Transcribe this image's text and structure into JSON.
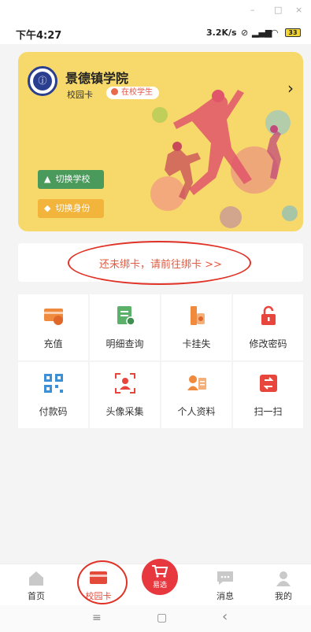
{
  "window": {
    "minimize": "–",
    "maximize": "□",
    "close": "×"
  },
  "status_bar": {
    "time": "下午4:27",
    "speed": "3.2K/s",
    "battery": "33"
  },
  "campus_card": {
    "school_name": "景德镇学院",
    "card_type": "校园卡",
    "status": "在校学生",
    "switch_school": "切换学校",
    "switch_role": "切换身份",
    "bg_color": "#f6d96a"
  },
  "bind_notice": {
    "text": "还未绑卡，请前往绑卡 >>"
  },
  "functions": [
    {
      "label": "充值",
      "icon": "recharge-card-icon",
      "color": "#f08a3c"
    },
    {
      "label": "明细查询",
      "icon": "detail-query-icon",
      "color": "#5bb06a"
    },
    {
      "label": "卡挂失",
      "icon": "card-loss-icon",
      "color": "#f08a3c"
    },
    {
      "label": "修改密码",
      "icon": "lock-icon",
      "color": "#e8453c"
    },
    {
      "label": "付款码",
      "icon": "qr-code-icon",
      "color": "#3d8fd6"
    },
    {
      "label": "头像采集",
      "icon": "avatar-capture-icon",
      "color": "#e8453c"
    },
    {
      "label": "个人资料",
      "icon": "profile-card-icon",
      "color": "#f08a3c"
    },
    {
      "label": "扫一扫",
      "icon": "scan-icon",
      "color": "#e8453c"
    }
  ],
  "tabs": [
    {
      "label": "首页",
      "icon": "home-icon"
    },
    {
      "label": "校园卡",
      "icon": "campus-card-icon"
    },
    {
      "label": "易选",
      "icon": "cart-icon"
    },
    {
      "label": "消息",
      "icon": "message-icon"
    },
    {
      "label": "我的",
      "icon": "user-icon"
    }
  ],
  "nav": {
    "menu": "≡",
    "home": "▢",
    "back": "‹"
  }
}
